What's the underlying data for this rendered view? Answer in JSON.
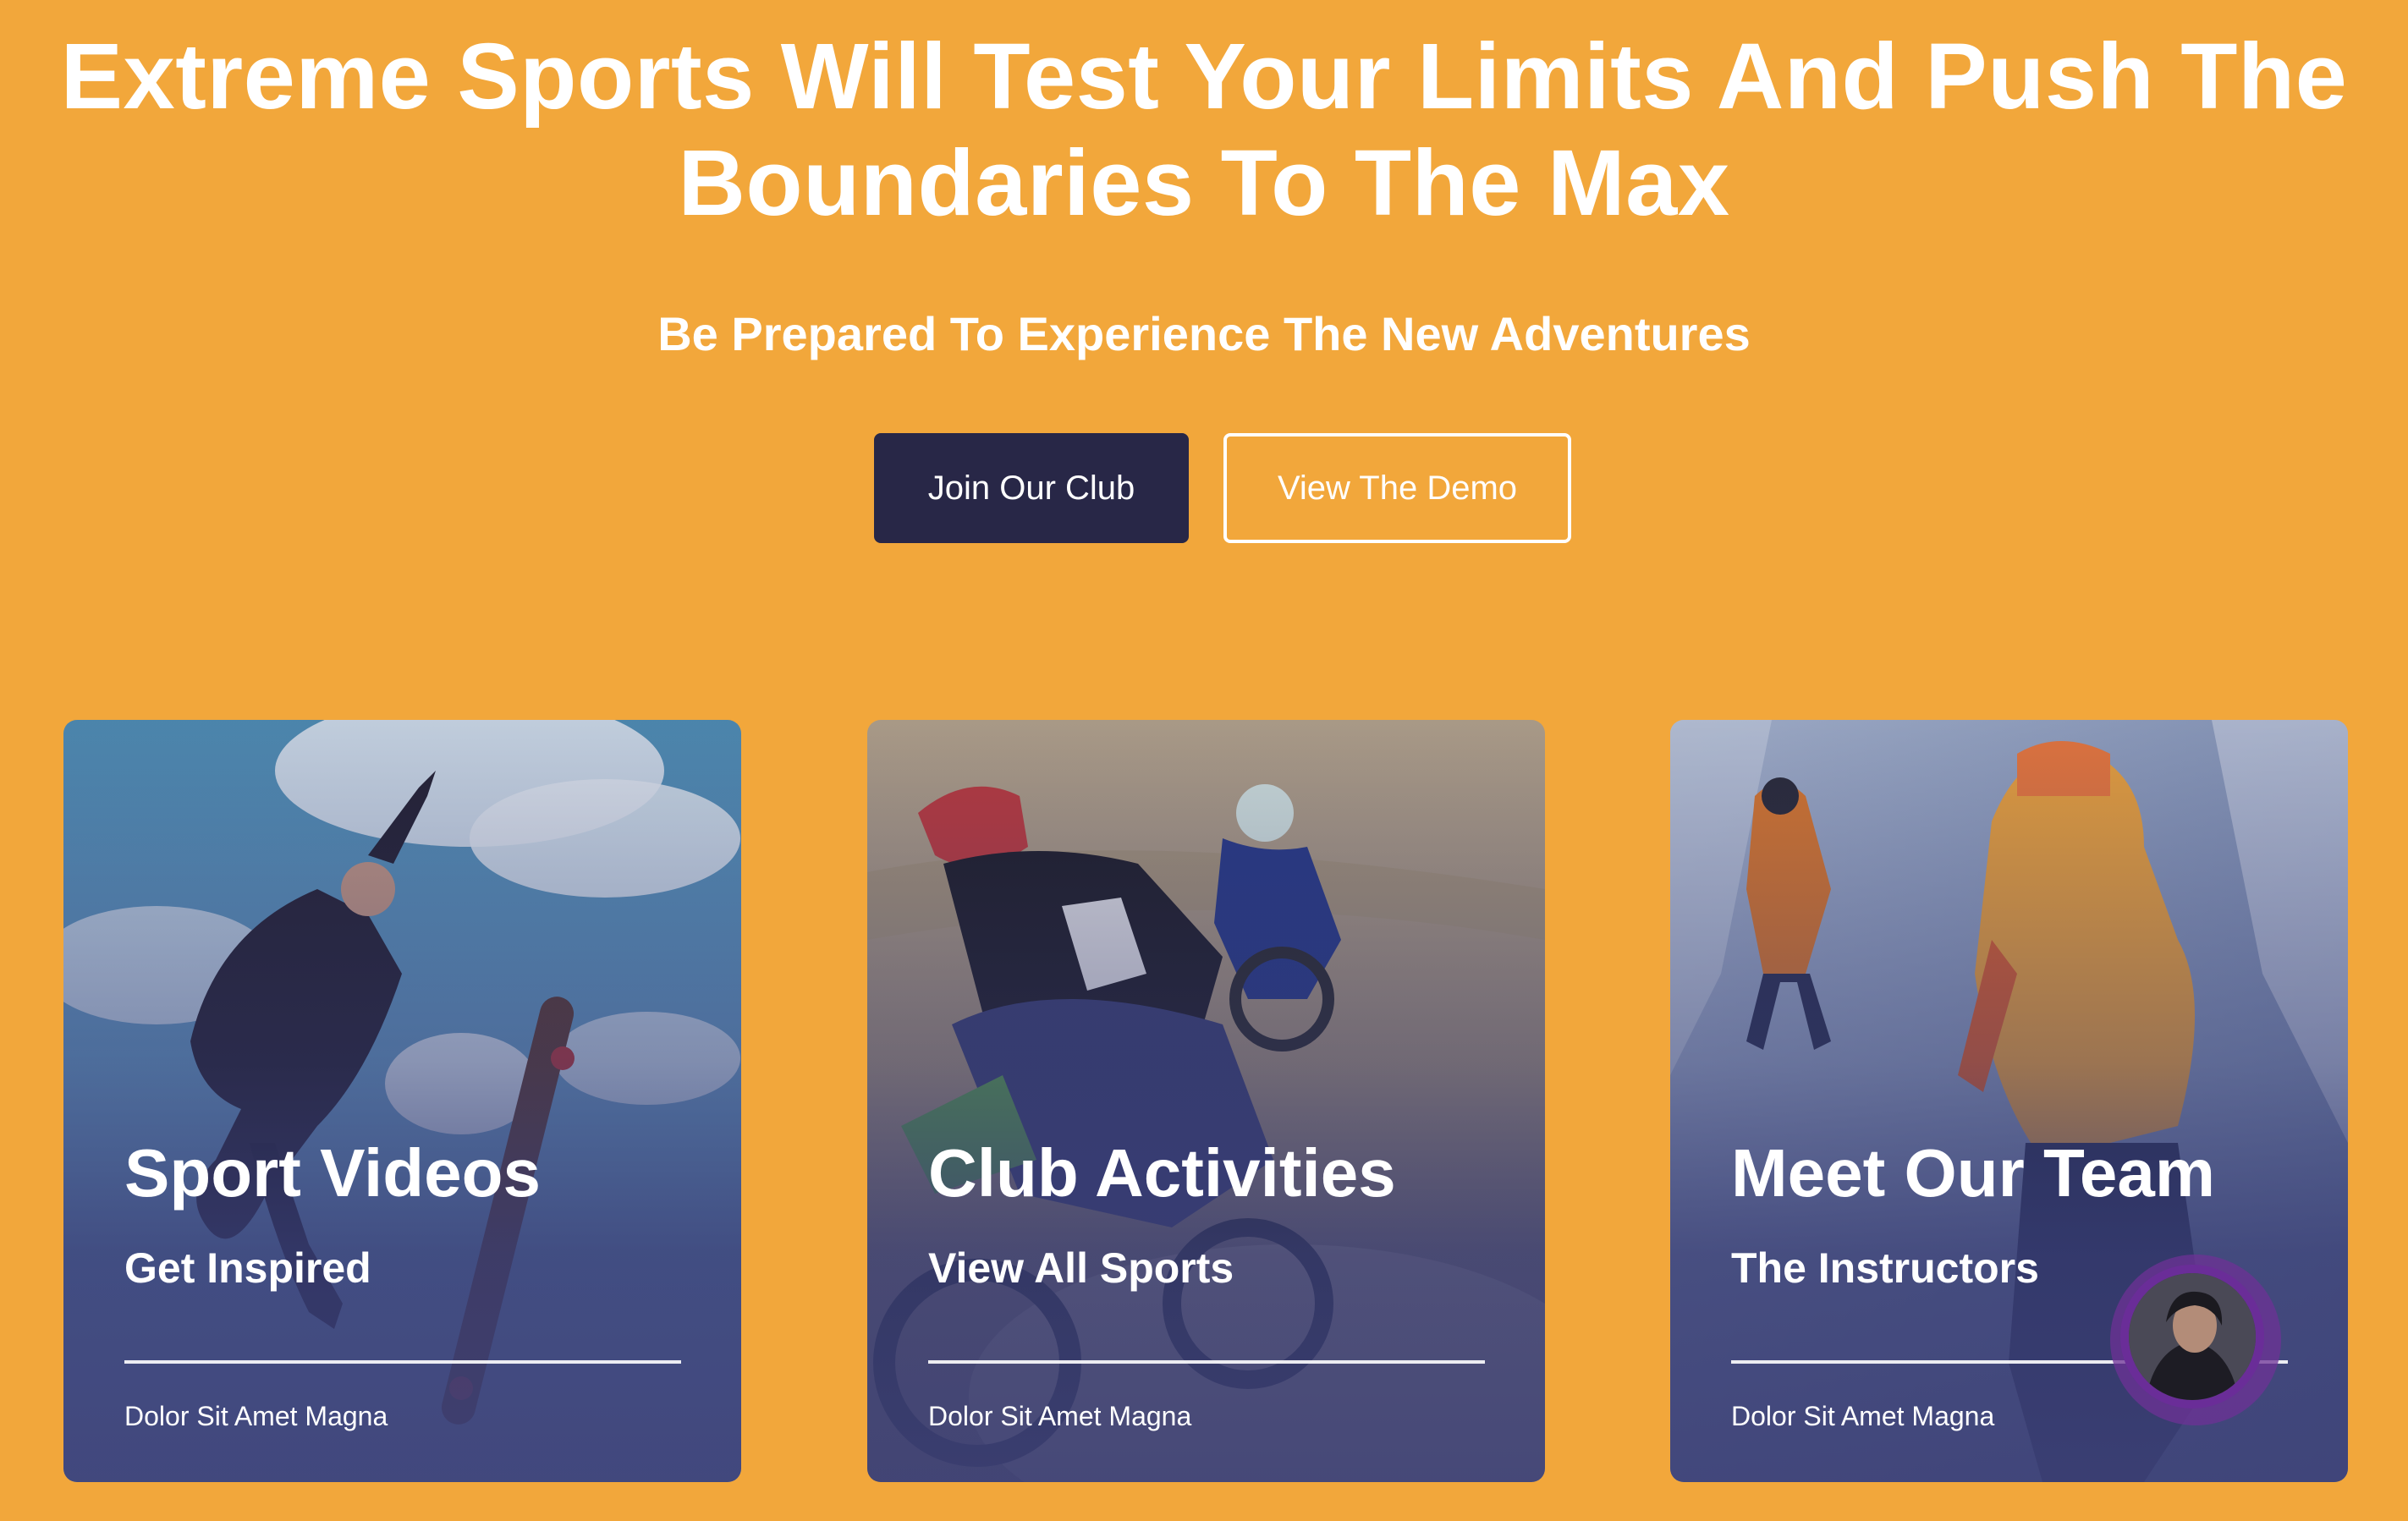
{
  "hero": {
    "title": "Extreme Sports Will Test Your Limits And Push The Boundaries To The Max",
    "subtitle": "Be Prepared To Experience The New Adventures",
    "primary_button": "Join Our Club",
    "secondary_button": "View The Demo"
  },
  "cards": [
    {
      "title": "Sport Videos",
      "subtitle": "Get Inspired",
      "meta": "Dolor Sit Amet Magna",
      "image": "skateboarder-jumping-photo"
    },
    {
      "title": "Club Activities",
      "subtitle": "View All Sports",
      "meta": "Dolor Sit Amet Magna",
      "image": "motocross-riders-photo"
    },
    {
      "title": "Meet Our Team",
      "subtitle": "The Instructors",
      "meta": "Dolor Sit Amet Magna",
      "image": "ice-climbers-photo"
    }
  ],
  "colors": {
    "background": "#F2A73B",
    "primary_button": "#282747",
    "card_overlay": "#3C4076",
    "text": "#FFFFFF",
    "avatar_ring": "#6A2D98"
  }
}
